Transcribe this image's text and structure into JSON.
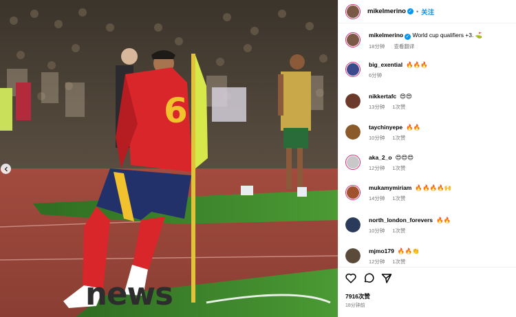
{
  "post": {
    "author": "mikelmerino",
    "follow_label": "关注",
    "caption": {
      "username": "mikelmerino",
      "text": "World cup qualifiers +3. ⛳",
      "time": "18分钟",
      "translate": "查看翻译"
    },
    "comments": [
      {
        "username": "big_exential",
        "text": "🔥🔥🔥",
        "time": "6分钟",
        "likes": "",
        "avatar_color": "#3a4a8c",
        "ring": true
      },
      {
        "username": "nikkertafc",
        "text": "😍😍",
        "time": "13分钟",
        "likes": "1次赞",
        "avatar_color": "#6b3a2a",
        "ring": false
      },
      {
        "username": "taychinyepe",
        "text": "🔥🔥",
        "time": "10分钟",
        "likes": "1次赞",
        "avatar_color": "#8a5a2a",
        "ring": false
      },
      {
        "username": "aka_2_o",
        "text": "😍😍😍",
        "time": "12分钟",
        "likes": "1次赞",
        "avatar_color": "#c8c8c8",
        "ring": true
      },
      {
        "username": "mukamymiriam",
        "text": "🔥🔥🔥🔥🙌",
        "time": "14分钟",
        "likes": "1次赞",
        "avatar_color": "#a0522d",
        "ring": true
      },
      {
        "username": "north_london_forevers",
        "text": "🔥🔥",
        "time": "10分钟",
        "likes": "1次赞",
        "avatar_color": "#2a3a5a",
        "ring": false
      },
      {
        "username": "mjmo179",
        "text": "🔥🔥👏",
        "time": "12分钟",
        "likes": "1次赞",
        "avatar_color": "#5a4a3a",
        "ring": false
      }
    ],
    "likes": "7916次赞",
    "posted_ago": "18分钟前"
  },
  "photo": {
    "jersey_number": "6"
  },
  "watermark": "news",
  "icons": [
    "heart-icon",
    "comment-icon",
    "share-icon",
    "chevron-left-icon",
    "verified-icon"
  ],
  "colors": {
    "accent_blue": "#0095f6",
    "story_ring": "#d62976",
    "muted_text": "#737373",
    "jersey_red": "#d9262a",
    "jersey_number_yellow": "#f2c12e",
    "corner_flag": "#d7e84a",
    "pitch_green": "#3f8a2c",
    "track_red": "#9b4438"
  }
}
